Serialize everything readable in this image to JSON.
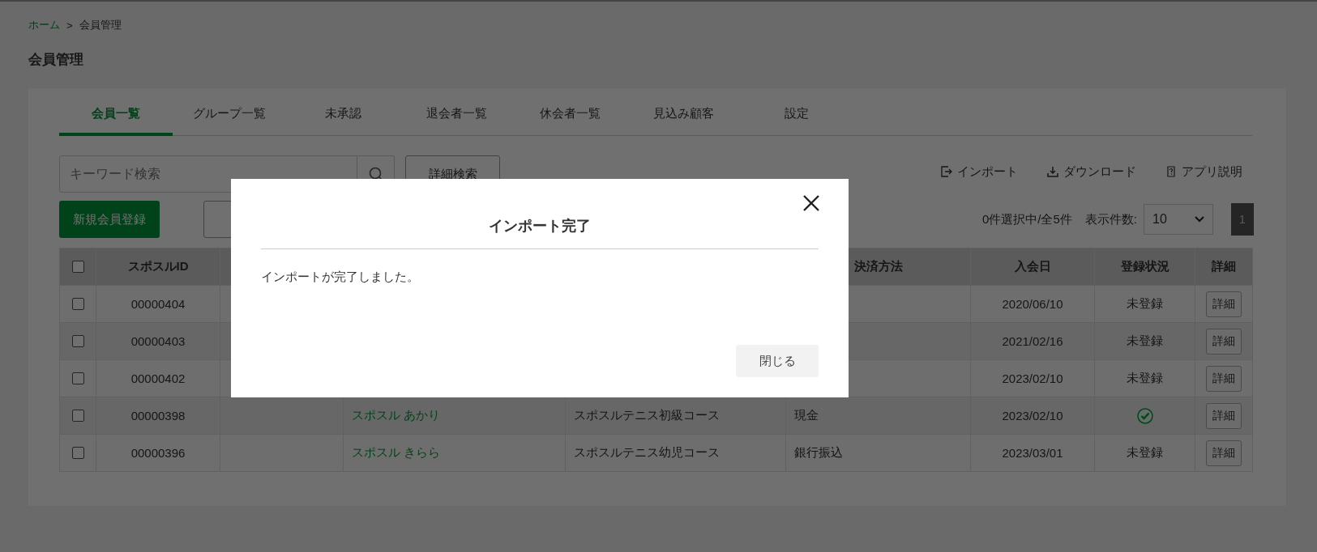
{
  "breadcrumb": {
    "items": [
      {
        "label": "ホーム",
        "kind": "link"
      },
      {
        "label": "会員管理",
        "kind": "current"
      }
    ],
    "separator": ">"
  },
  "page_title": "会員管理",
  "tabs": [
    {
      "label": "会員一覧",
      "selected": true
    },
    {
      "label": "グループ一覧",
      "selected": false
    },
    {
      "label": "未承認",
      "selected": false
    },
    {
      "label": "退会者一覧",
      "selected": false
    },
    {
      "label": "休会者一覧",
      "selected": false
    },
    {
      "label": "見込み顧客",
      "selected": false
    },
    {
      "label": "設定",
      "selected": false
    }
  ],
  "search": {
    "placeholder": "キーワード検索",
    "advanced_button": "詳細検索"
  },
  "actions": [
    {
      "label": "インポート",
      "kind": "import"
    },
    {
      "label": "ダウンロード",
      "kind": "download"
    },
    {
      "label": "アプリ説明",
      "kind": "help"
    }
  ],
  "new_member_button": "新規会員登録",
  "selection_count": "0件選択中/全5件",
  "page_size": {
    "label": "表示件数:",
    "value": "10"
  },
  "pages": [
    {
      "label": "1",
      "selected": true
    }
  ],
  "table": {
    "columns": [
      {
        "kind": "checkbox",
        "checked": false
      },
      {
        "kind": "text",
        "heading": "スポスルID"
      },
      {
        "kind": "text"
      },
      {
        "kind": "text"
      },
      {
        "kind": "text"
      },
      {
        "kind": "text",
        "heading": "決済方法"
      },
      {
        "kind": "text",
        "heading": "入会日"
      },
      {
        "kind": "text",
        "heading": "登録状況"
      },
      {
        "kind": "text",
        "heading": "詳細"
      }
    ],
    "rows": [
      {
        "checked": false,
        "id": "00000404",
        "joined": "2020/06/10",
        "registered": false,
        "status": "未登録",
        "detail": "詳細"
      },
      {
        "checked": false,
        "id": "00000403",
        "joined": "2021/02/16",
        "registered": false,
        "status": "未登録",
        "detail": "詳細"
      },
      {
        "checked": false,
        "id": "00000402",
        "joined": "2023/02/10",
        "registered": false,
        "status": "未登録",
        "detail": "詳細"
      },
      {
        "checked": false,
        "id": "00000398",
        "column_4": "スポスル あかり",
        "column_5": "スポスルテニス初級コース",
        "payment": "現金",
        "joined": "2023/02/10",
        "registered": true,
        "detail": "詳細"
      },
      {
        "checked": false,
        "id": "00000396",
        "column_4": "スポスル きらら",
        "column_5": "スポスルテニス幼児コース",
        "payment": "銀行振込",
        "joined": "2023/03/01",
        "registered": false,
        "status": "未登録",
        "detail": "詳細"
      }
    ]
  },
  "dialog": {
    "title": "インポート完了",
    "message": "インポートが完了しました。",
    "close_button": "閉じる"
  }
}
